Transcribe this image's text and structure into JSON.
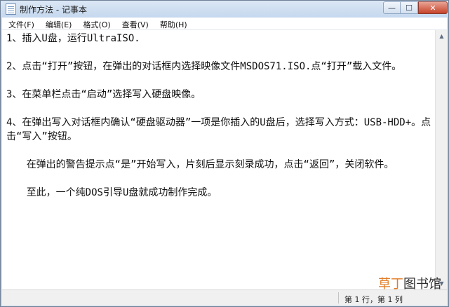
{
  "window": {
    "title": "制作方法 - 记事本",
    "minimize_glyph": "—",
    "maximize_glyph": "☐",
    "close_glyph": "✕"
  },
  "menu": [
    "文件(F)",
    "编辑(E)",
    "格式(O)",
    "查看(V)",
    "帮助(H)"
  ],
  "document": {
    "paragraphs": [
      {
        "text": "1、插入U盘，运行UltraISO.",
        "indent": false
      },
      {
        "text": "2、点击“打开”按钮，在弹出的对话框内选择映像文件MSDOS71.ISO.点“打开”载入文件。",
        "indent": false
      },
      {
        "text": "3、在菜单栏点击“启动”选择写入硬盘映像。",
        "indent": false
      },
      {
        "text": "4、在弹出写入对话框内确认“硬盘驱动器”一项是你插入的U盘后，选择写入方式：USB-HDD+。点击“写入”按钮。",
        "indent": false
      },
      {
        "text": "在弹出的警告提示点“是”开始写入，片刻后显示刻录成功，点击“返回”，关闭软件。",
        "indent": true
      },
      {
        "text": "至此，一个纯DOS引导U盘就成功制作完成。",
        "indent": true
      }
    ]
  },
  "scrollbar": {
    "up_glyph": "▲",
    "down_glyph": "▼"
  },
  "status": {
    "position": "第 1 行，第 1 列"
  },
  "watermark": {
    "part1": "草丁",
    "part2": "图书馆"
  }
}
